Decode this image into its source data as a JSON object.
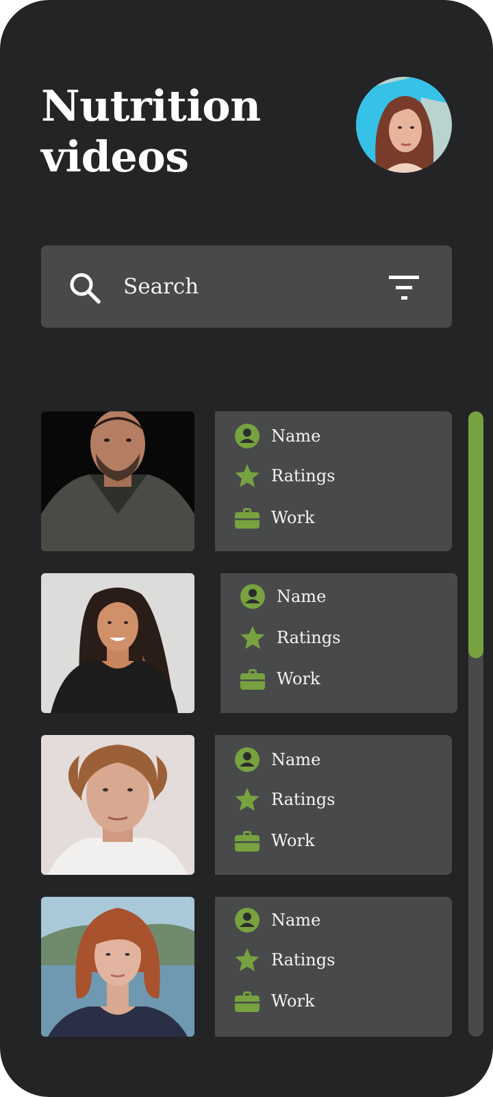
{
  "page": {
    "title_line1": "Nutrition",
    "title_line2": "videos"
  },
  "search": {
    "placeholder": "Search"
  },
  "cards": [
    {
      "name_label": "Name",
      "ratings_label": "Ratings",
      "work_label": "Work"
    },
    {
      "name_label": "Name",
      "ratings_label": "Ratings",
      "work_label": "Work"
    },
    {
      "name_label": "Name",
      "ratings_label": "Ratings",
      "work_label": "Work"
    },
    {
      "name_label": "Name",
      "ratings_label": "Ratings",
      "work_label": "Work"
    }
  ],
  "icons": {
    "search": "search-icon",
    "filter": "filter-icon",
    "name": "person-icon",
    "ratings": "star-icon",
    "work": "briefcase-icon"
  },
  "colors": {
    "background": "#232426",
    "panel": "#48494b",
    "accent": "#77a23f",
    "text": "#ffffff"
  }
}
